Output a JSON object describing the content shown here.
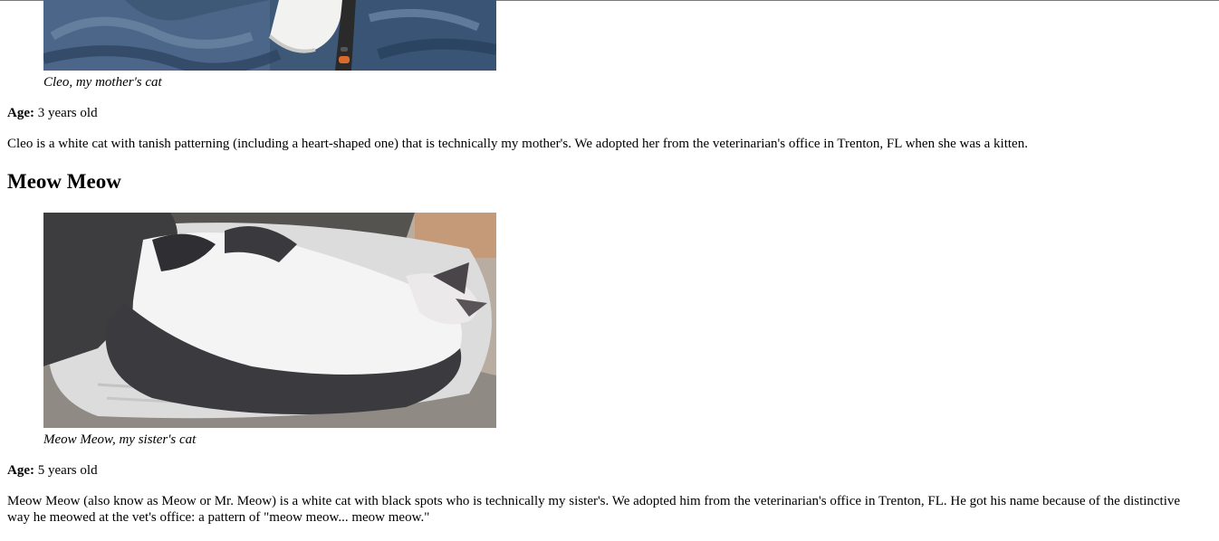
{
  "cleo": {
    "caption": "Cleo, my mother's cat",
    "age_label": "Age:",
    "age_value": "3 years old",
    "description": "Cleo is a white cat with tanish patterning (including a heart-shaped one) that is technically my mother's. We adopted her from the veterinarian's office in Trenton, FL when she was a kitten."
  },
  "meow_meow": {
    "heading": "Meow Meow",
    "caption": "Meow Meow, my sister's cat",
    "age_label": "Age:",
    "age_value": "5 years old",
    "description": "Meow Meow (also know as Meow or Mr. Meow) is a white cat with black spots who is technically my sister's. We adopted him from the veterinarian's office in Trenton, FL. He got his name because of the distinctive way he meowed at the vet's office: a pattern of \"meow meow... meow meow.\""
  }
}
